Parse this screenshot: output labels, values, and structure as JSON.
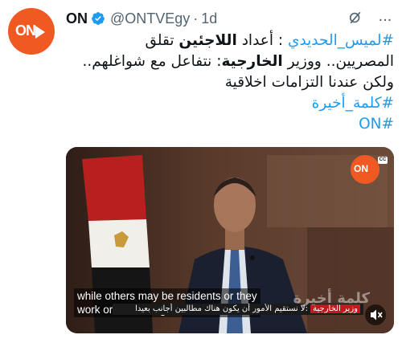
{
  "account": {
    "name": "ON",
    "handle": "@ONTVEgy",
    "separator": "·",
    "time": "1d",
    "avatar_text": "ON",
    "brand_color": "#f05a22",
    "verified_color": "#1d9bf0",
    "more_label": "..."
  },
  "tweet": {
    "line1": {
      "hashtag": "#لميس_الحديدي",
      "text_a": " : أعداد ",
      "bold": "اللاجئين",
      "text_b": " تقلق"
    },
    "line2": {
      "text_a": "المصريين.. ووزير ",
      "bold": "الخارجية",
      "text_b": ": نتفاعل مع شواغلهم.."
    },
    "line3": "ولكن عندنا التزامات اخلاقية",
    "hashtag2": "#كلمة_أخيرة",
    "hashtag3": "#ON",
    "hashtag_color": "#1d9bf0"
  },
  "video": {
    "badge_text": "ON",
    "cc_label": "CC",
    "caption_line1": "while others may be residents or they",
    "caption_line2": "work or something like that",
    "lower_third_label": "وزير الخارجية",
    "lower_third_text": ":لا نستقيم الأمور أن يكون هناك مطالبين أجانب بعيدا",
    "watermark": "كلمة أخيرة",
    "mute_icon": "speaker-muted-icon"
  }
}
